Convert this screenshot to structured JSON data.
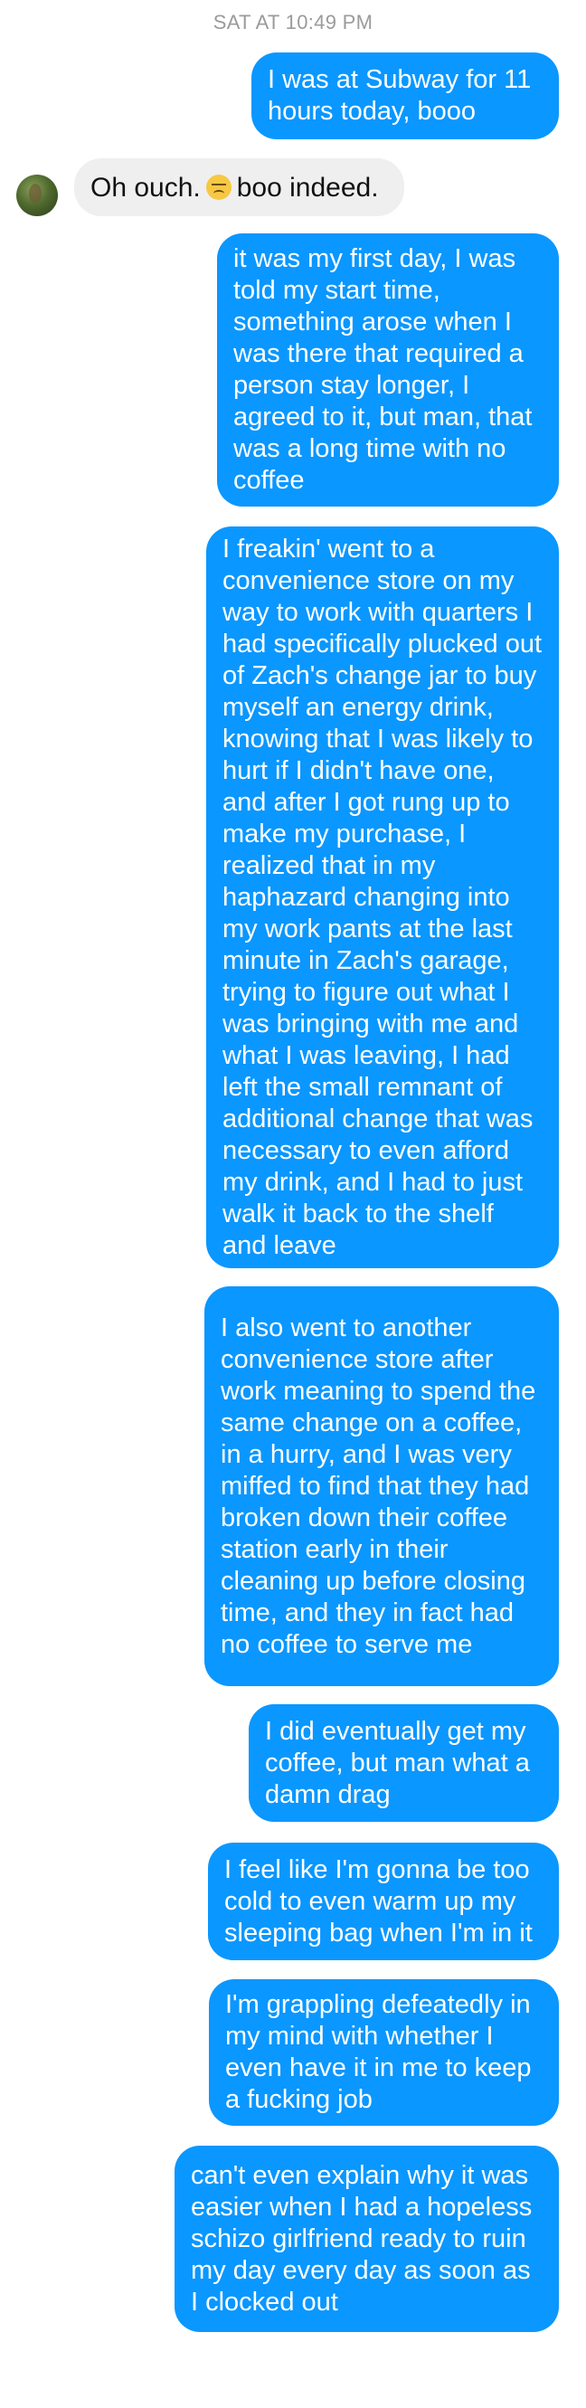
{
  "conversation": {
    "timestamp": "SAT AT 10:49 PM",
    "messages": [
      {
        "id": "m1",
        "direction": "outgoing",
        "text": "I was at Subway for 11 hours today, booo"
      },
      {
        "id": "m2",
        "direction": "incoming",
        "text_before": "Oh ouch.",
        "emoji": "disappointed-face-emoji",
        "text_after": "boo indeed."
      },
      {
        "id": "m3",
        "direction": "outgoing",
        "text": "it was my first day, I was told my start time, something arose when I was there that required a person stay longer, I agreed to it, but man, that was a long time with no coffee"
      },
      {
        "id": "m4",
        "direction": "outgoing",
        "text": "I freakin' went to a convenience store on my way to work with quarters I had specifically plucked out of Zach's change jar to buy myself an energy drink, knowing that I was likely to hurt if I didn't have one, and after I got rung up to make my purchase, I realized that in my haphazard changing into my work pants at the last minute in Zach's garage, trying to figure out what I was bringing with me and what I was leaving, I had left the small remnant of additional change that was necessary to even afford my drink, and I had to just walk it back to the shelf and leave"
      },
      {
        "id": "m5",
        "direction": "outgoing",
        "text": "I also went to another convenience store after work meaning to spend the same change on a coffee, in a hurry, and I was very miffed to find that they had broken down their coffee station early in their cleaning up before closing time, and they in fact had no coffee to serve me"
      },
      {
        "id": "m6",
        "direction": "outgoing",
        "text": "I did eventually get my coffee, but man what a damn drag"
      },
      {
        "id": "m7",
        "direction": "outgoing",
        "text": "I feel like I'm gonna be too cold to even warm up my sleeping bag when I'm in it"
      },
      {
        "id": "m8",
        "direction": "outgoing",
        "text": "I'm grappling defeatedly in my mind with whether I even have it in me to keep a fucking job"
      },
      {
        "id": "m9",
        "direction": "outgoing",
        "text": "can't even explain why it was easier when I had a hopeless schizo girlfriend ready to ruin my day every day as soon as I clocked out"
      }
    ]
  },
  "colors": {
    "outgoing_bubble": "#0a97ff",
    "incoming_bubble": "#efefef",
    "timestamp_text": "#9b9b9b"
  }
}
